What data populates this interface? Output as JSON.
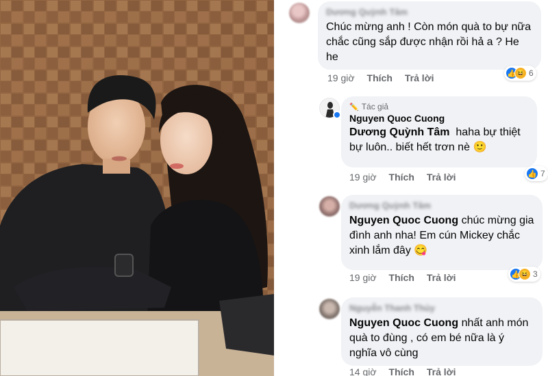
{
  "photo": {
    "alt": "couple-photo"
  },
  "comments": [
    {
      "author_name": "Dương Quỳnh Tâm",
      "text": "Chúc mừng anh ! Còn món quà to bự nữa chắc cũng sắp được nhận rồi hả a ? He he",
      "time": "19 giờ",
      "like_label": "Thích",
      "reply_label": "Trả lời",
      "reaction_count": "6"
    },
    {
      "author_badge": "Tác giả",
      "author_name": "Nguyen Quoc Cuong",
      "mention": "Dương Quỳnh Tâm",
      "text": "haha bự thiệt bự luôn.. biết hết trơn nè",
      "emoji": "🙂",
      "time": "19 giờ",
      "like_label": "Thích",
      "reply_label": "Trả lời",
      "reaction_count": "7"
    },
    {
      "author_name": "Dương Quỳnh Tâm",
      "mention": "Nguyen Quoc Cuong",
      "text": "chúc mừng gia đình anh nha! Em cún Mickey chắc xinh lắm đây",
      "emoji": "😋",
      "time": "19 giờ",
      "like_label": "Thích",
      "reply_label": "Trả lời",
      "reaction_count": "3"
    },
    {
      "author_name": "Nguyễn Thanh Thủy",
      "mention": "Nguyen Quoc Cuong",
      "text": "nhất anh món quà to đùng , có em bé nữa là ý nghĩa vô cùng",
      "time": "14 giờ",
      "like_label": "Thích",
      "reply_label": "Trả lời"
    }
  ],
  "colors": {
    "bubble": "#f0f2f5",
    "like_blue": "#1877f2",
    "haha_yellow": "#f7b125",
    "meta_gray": "#65676b"
  }
}
